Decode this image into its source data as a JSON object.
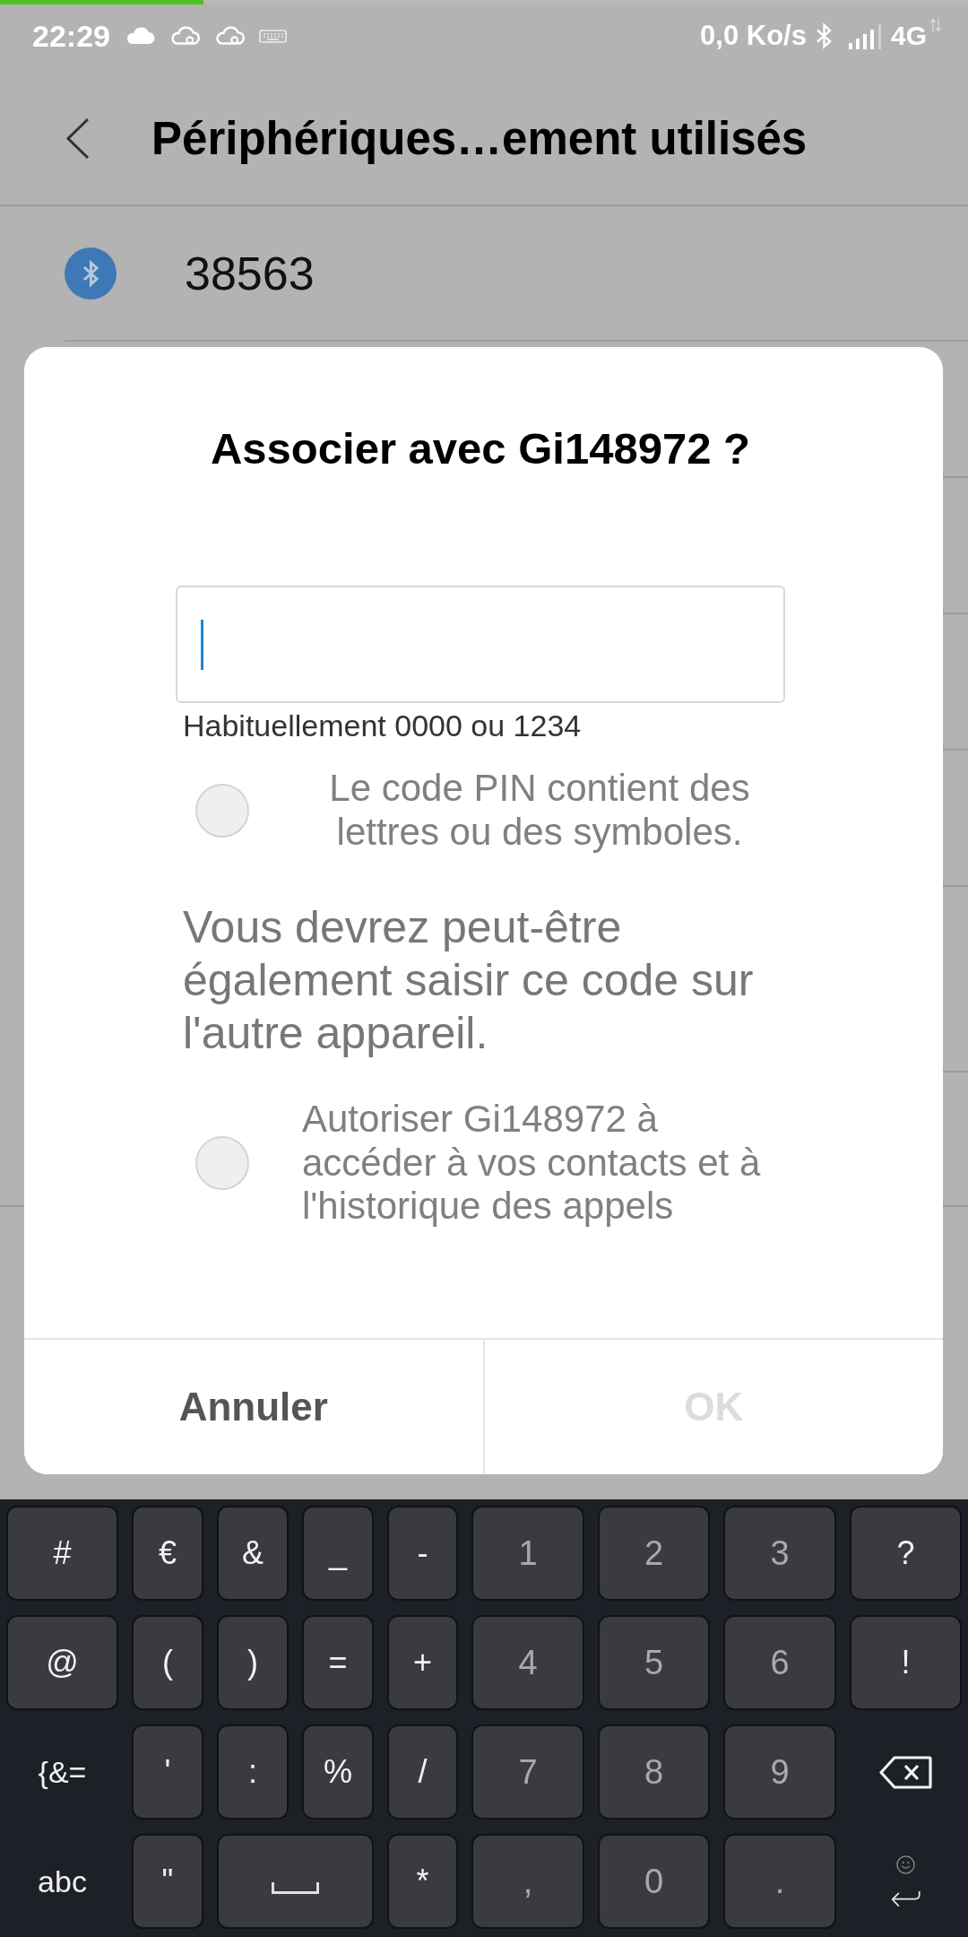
{
  "status_bar": {
    "loading_bar": {
      "level": 0.21
    },
    "time": "22:29",
    "data_rate": "0,0 Ko/s",
    "network": "4G"
  },
  "header": {
    "title": "Périphériques…ement utilisés"
  },
  "devices": [
    {
      "name": "38563"
    }
  ],
  "dialog": {
    "title": "Associer avec Gi148972 ?",
    "pin_field": {
      "focused": true
    },
    "pin_hint": "Habituellement 0000 ou 1234",
    "items": [
      {
        "kind": "checkbox",
        "label": "Le code PIN contient des lettres ou des symboles.",
        "checked": false
      },
      {
        "kind": "note",
        "text": "Vous devrez peut-être également saisir ce code sur l'autre appareil."
      },
      {
        "kind": "checkbox",
        "label": "Autoriser Gi148972 à accéder à vos contacts et à l'historique des appels",
        "checked": false
      }
    ],
    "buttons": [
      {
        "label": "Annuler",
        "disabled": false
      },
      {
        "label": "OK",
        "disabled": true
      }
    ]
  },
  "keyboard": {
    "rows": [
      [
        {
          "kind": "symbol",
          "label": "#"
        },
        {
          "kind": "symbol",
          "label": "€"
        },
        {
          "kind": "symbol",
          "label": "&"
        },
        {
          "kind": "symbol",
          "label": "_"
        },
        {
          "kind": "symbol",
          "label": "-"
        },
        {
          "kind": "numpad",
          "label": "1"
        },
        {
          "kind": "numpad",
          "label": "2"
        },
        {
          "kind": "numpad",
          "label": "3"
        },
        {
          "kind": "symbol",
          "label": "?"
        }
      ],
      [
        {
          "kind": "symbol",
          "label": "@"
        },
        {
          "kind": "symbol",
          "label": "("
        },
        {
          "kind": "symbol",
          "label": ")"
        },
        {
          "kind": "symbol",
          "label": "="
        },
        {
          "kind": "symbol",
          "label": "+"
        },
        {
          "kind": "numpad",
          "label": "4"
        },
        {
          "kind": "numpad",
          "label": "5"
        },
        {
          "kind": "numpad",
          "label": "6"
        },
        {
          "kind": "symbol",
          "label": "!"
        }
      ],
      [
        {
          "kind": "mode",
          "label": "{&="
        },
        {
          "kind": "symbol",
          "label": "'"
        },
        {
          "kind": "symbol",
          "label": ":"
        },
        {
          "kind": "symbol",
          "label": "%"
        },
        {
          "kind": "symbol",
          "label": "/"
        },
        {
          "kind": "numpad",
          "label": "7"
        },
        {
          "kind": "numpad",
          "label": "8"
        },
        {
          "kind": "numpad",
          "label": "9"
        },
        {
          "kind": "backspace"
        }
      ],
      [
        {
          "kind": "mode",
          "label": "abc"
        },
        {
          "kind": "symbol",
          "label": "\""
        },
        {
          "kind": "space",
          "colspan": 2
        },
        {
          "kind": "symbol",
          "label": "*"
        },
        {
          "kind": "numpad",
          "label": ","
        },
        {
          "kind": "numpad",
          "label": "0"
        },
        {
          "kind": "numpad",
          "label": "."
        },
        {
          "kind": "enter"
        }
      ]
    ]
  }
}
